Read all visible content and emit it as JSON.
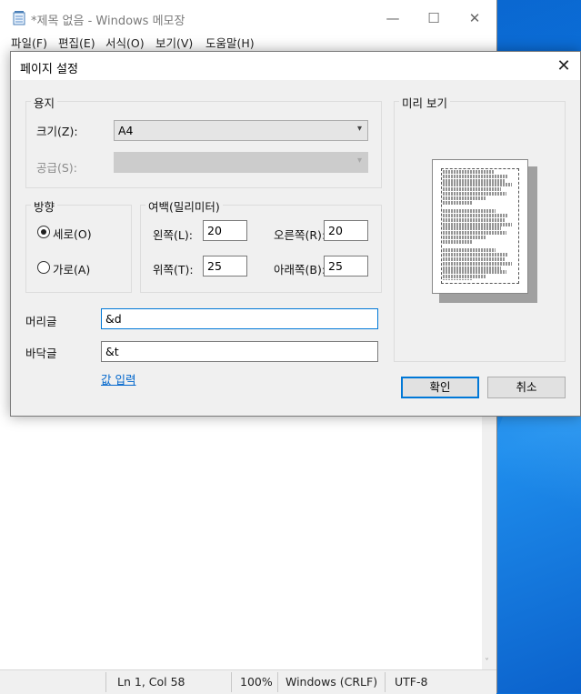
{
  "notepad": {
    "title": "*제목 없음 - Windows 메모장",
    "menu": [
      "파일(F)",
      "편집(E)",
      "서식(O)",
      "보기(V)",
      "도움말(H)"
    ],
    "controls": {
      "minimize": "—",
      "maximize": "☐",
      "close": "✕"
    },
    "status": {
      "position": "Ln 1, Col 58",
      "zoom": "100%",
      "line_ending": "Windows (CRLF)",
      "encoding": "UTF-8"
    }
  },
  "dialog": {
    "title": "페이지 설정",
    "close": "✕",
    "paper": {
      "group": "용지",
      "size_label": "크기(Z):",
      "size_value": "A4",
      "source_label": "공급(S):",
      "source_value": ""
    },
    "orientation": {
      "group": "방향",
      "portrait": "세로(O)",
      "landscape": "가로(A)",
      "selected": "portrait"
    },
    "margins": {
      "group": "여백(밀리미터)",
      "left_label": "왼쪽(L):",
      "left_value": "20",
      "right_label": "오른쪽(R):",
      "right_value": "20",
      "top_label": "위쪽(T):",
      "top_value": "25",
      "bottom_label": "아래쪽(B):",
      "bottom_value": "25"
    },
    "header_label": "머리글",
    "header_value": "&d",
    "footer_label": "바닥글",
    "footer_value": "&t",
    "input_values_link": "값 입력",
    "preview_group": "미리 보기",
    "ok": "확인",
    "cancel": "취소"
  },
  "icons": {
    "chevron": "chevron-down-icon",
    "notepad": "notepad-icon"
  }
}
